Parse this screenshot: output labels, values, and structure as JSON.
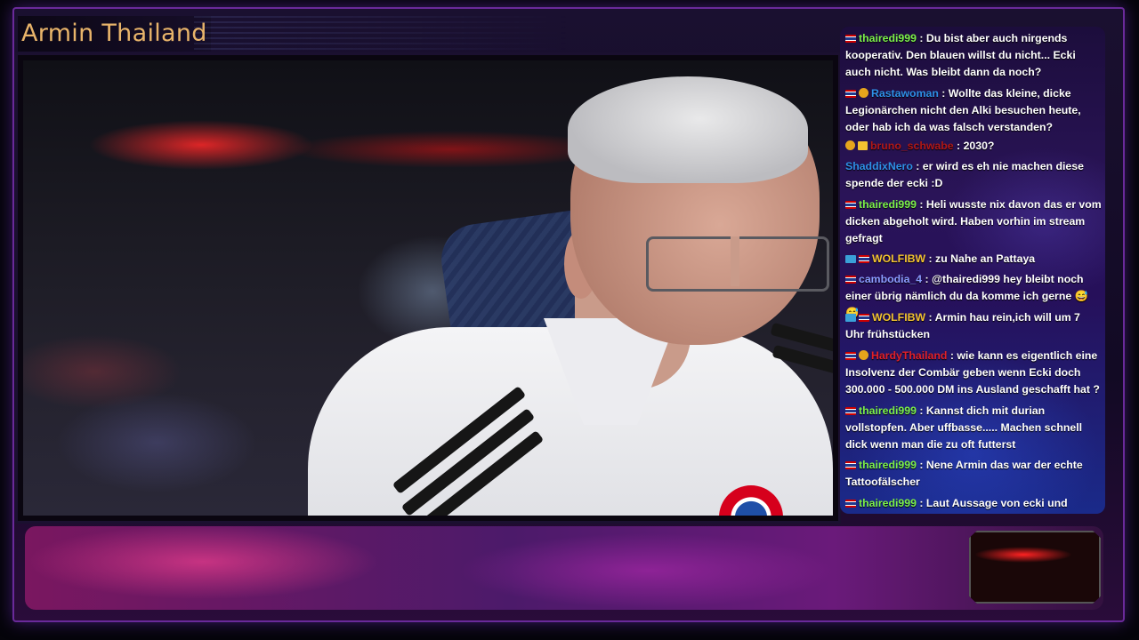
{
  "stream": {
    "title": "Armin Thailand"
  },
  "colors": {
    "title": "#e8b46a",
    "frame_border": "#6a2a9a"
  },
  "chat": {
    "messages": [
      {
        "badges": [
          "flag"
        ],
        "user": "thairedi999",
        "color": "#7cf04a",
        "text": "Du bist aber auch nirgends kooperativ. Den blauen willst du nicht... Ecki auch nicht. Was bleibt dann da noch?"
      },
      {
        "badges": [
          "flag",
          "coin"
        ],
        "user": "Rastawoman",
        "color": "#2e8fe6",
        "text": "Wollte das kleine, dicke Legionärchen nicht den Alki besuchen heute, oder hab ich da was falsch verstanden?"
      },
      {
        "badges": [
          "coin",
          "crown"
        ],
        "user": "bruno_schwabe",
        "color": "#b01818",
        "text": "2030?"
      },
      {
        "badges": [],
        "user": "ShaddixNero",
        "color": "#2e8fe6",
        "text": "er wird es eh nie machen diese spende der ecki :D"
      },
      {
        "badges": [
          "flag"
        ],
        "user": "thairedi999",
        "color": "#7cf04a",
        "text": "Heli wusste nix davon das er vom dicken abgeholt wird. Haben vorhin im stream gefragt"
      },
      {
        "badges": [
          "prime",
          "flag"
        ],
        "user": "WOLFIBW",
        "color": "#f2c230",
        "text": "zu Nahe an Pattaya"
      },
      {
        "badges": [
          "flag"
        ],
        "user": "cambodia_4",
        "color": "#8a9cff",
        "text": "@thairedi999 hey bleibt noch einer übrig nämlich du da komme ich gerne 😅 😅"
      },
      {
        "badges": [
          "prime",
          "flag"
        ],
        "user": "WOLFIBW",
        "color": "#f2c230",
        "text": "Armin hau rein,ich will um 7 Uhr frühstücken"
      },
      {
        "badges": [
          "flag",
          "coin"
        ],
        "user": "HardyThailand",
        "color": "#e0202a",
        "text": "wie kann es eigentlich eine Insolvenz der Combär geben wenn Ecki doch 300.000 - 500.000 DM ins Ausland geschafft hat ?"
      },
      {
        "badges": [
          "flag"
        ],
        "user": "thairedi999",
        "color": "#7cf04a",
        "text": "Kannst dich mit durian vollstopfen. Aber uffbasse..... Machen schnell dick wenn man die zu oft futterst"
      },
      {
        "badges": [
          "flag"
        ],
        "user": "thairedi999",
        "color": "#7cf04a",
        "text": "Nene Armin das war der echte Tattoofälscher"
      },
      {
        "badges": [
          "flag"
        ],
        "user": "thairedi999",
        "color": "#7cf04a",
        "text": "Laut Aussage von ecki und diddel"
      }
    ]
  }
}
